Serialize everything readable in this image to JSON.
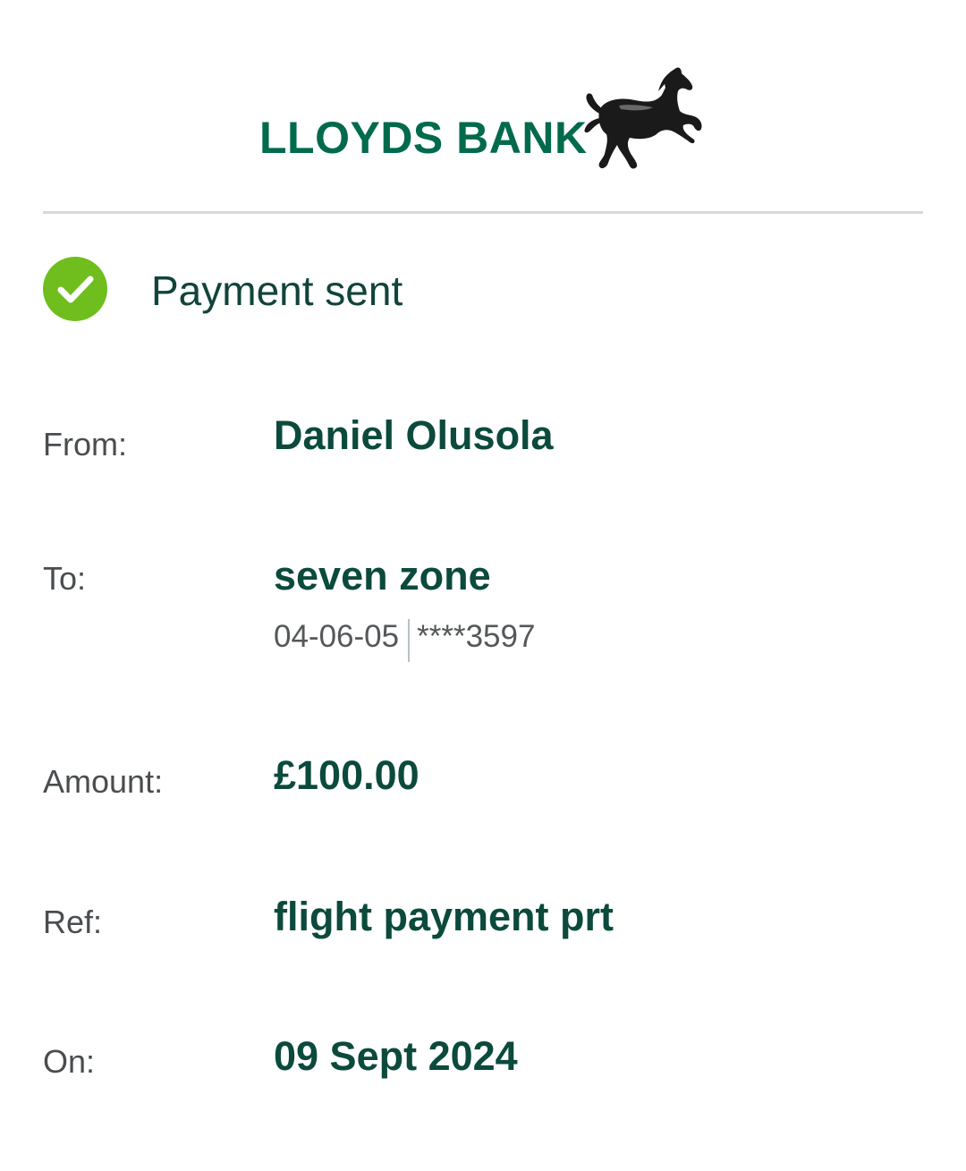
{
  "brand": {
    "name": "LLOYDS BANK",
    "color": "#006a4d",
    "logo_icon": "black-horse-icon"
  },
  "status": {
    "icon": "check-circle-icon",
    "icon_color": "#6fbe1e",
    "text": "Payment sent"
  },
  "details": {
    "from_label": "From:",
    "from_value": "Daniel Olusola",
    "to_label": "To:",
    "to_value": "seven zone",
    "sort_code": "04-06-05",
    "account_masked": "****3597",
    "amount_label": "Amount:",
    "amount_value": "£100.00",
    "ref_label": "Ref:",
    "ref_value": "flight payment prt",
    "on_label": "On:",
    "on_value": "09 Sept 2024"
  }
}
